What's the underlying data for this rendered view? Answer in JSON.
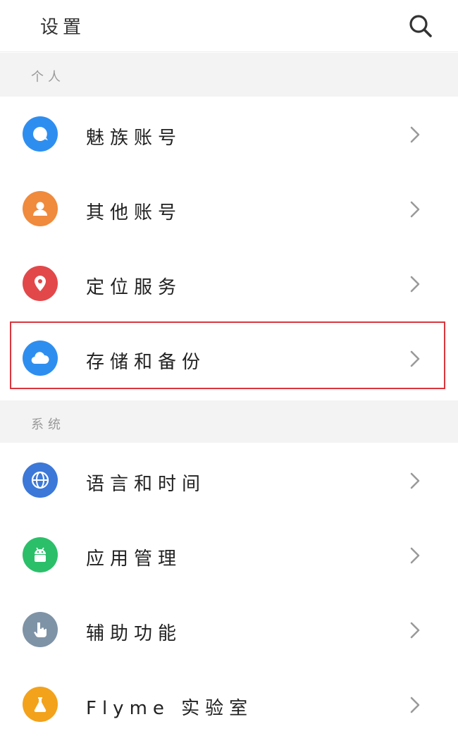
{
  "header": {
    "title": "设置",
    "search_icon": "search-icon"
  },
  "sections": [
    {
      "label": "个人"
    },
    {
      "label": "系统"
    }
  ],
  "items": [
    {
      "label": "魅族账号",
      "icon": "flyme-account-icon",
      "color": "#2e8ef0"
    },
    {
      "label": "其他账号",
      "icon": "person-icon",
      "color": "#f08a3c"
    },
    {
      "label": "定位服务",
      "icon": "location-pin-icon",
      "color": "#e2484a"
    },
    {
      "label": "存储和备份",
      "icon": "cloud-icon",
      "color": "#2e8ef0"
    },
    {
      "label": "语言和时间",
      "icon": "globe-icon",
      "color": "#3b78d8"
    },
    {
      "label": "应用管理",
      "icon": "android-icon",
      "color": "#2bbf6a"
    },
    {
      "label": "辅助功能",
      "icon": "hand-pointer-icon",
      "color": "#7f93a6"
    },
    {
      "label": "Flyme 实验室",
      "icon": "flask-icon",
      "color": "#f3a21b"
    }
  ],
  "highlight_color": "#d9363e"
}
